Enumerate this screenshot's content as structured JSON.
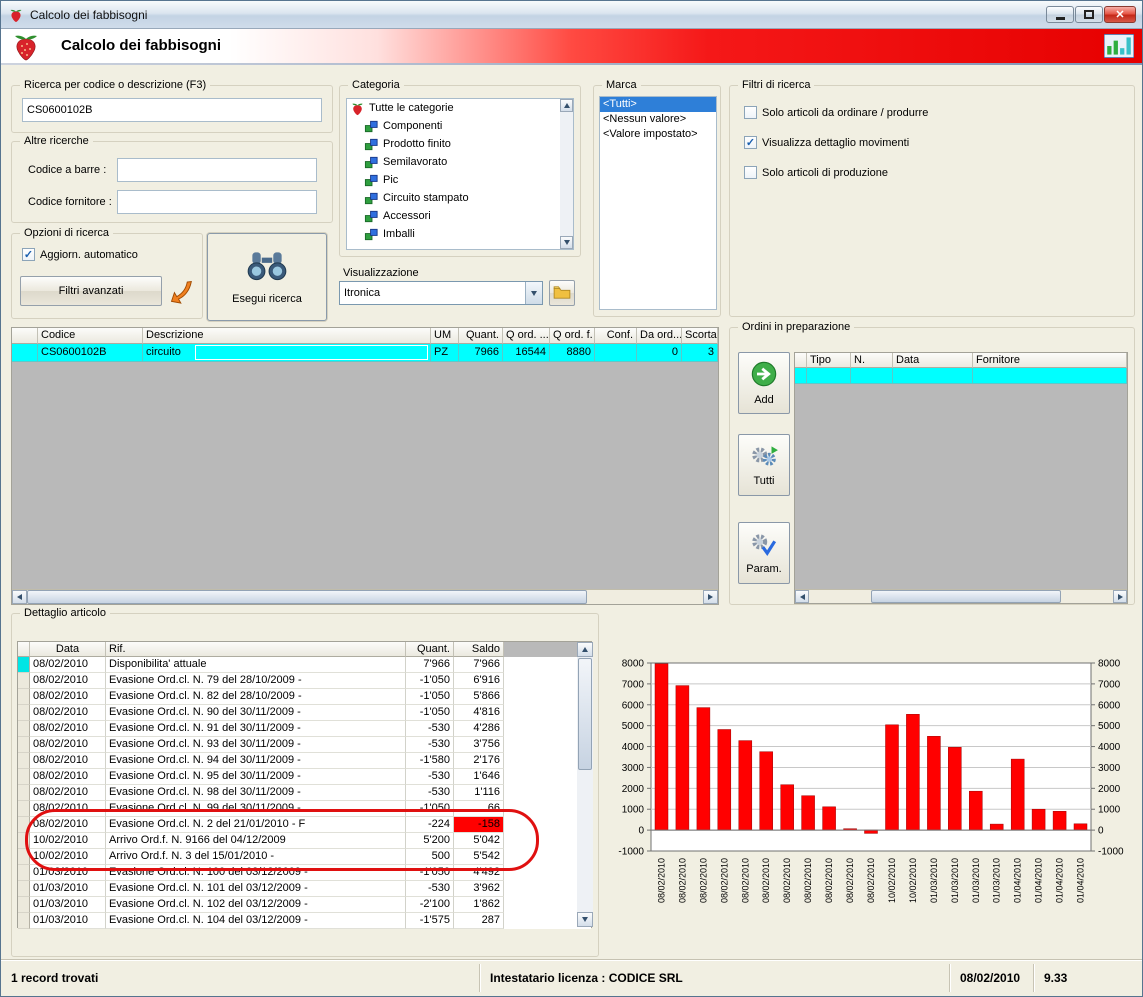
{
  "window": {
    "title": "Calcolo dei fabbisogni"
  },
  "banner": {
    "title": "Calcolo dei fabbisogni",
    "accent_color": "#e60000"
  },
  "search": {
    "group_label": "Ricerca per codice o descrizione (F3)",
    "value": "CS0600102B"
  },
  "other_search": {
    "group_label": "Altre ricerche",
    "barcode_label": "Codice a barre :",
    "barcode_value": "",
    "supplier_label": "Codice fornitore :",
    "supplier_value": ""
  },
  "options": {
    "group_label": "Opzioni di ricerca",
    "auto_update_label": "Aggiorn. automatico",
    "auto_update_checked": true,
    "advanced_filters_label": "Filtri avanzati"
  },
  "actions": {
    "execute_label": "Esegui ricerca"
  },
  "category": {
    "group_label": "Categoria",
    "items": [
      {
        "label": "Tutte le categorie",
        "root": true
      },
      {
        "label": "Componenti"
      },
      {
        "label": "Prodotto finito"
      },
      {
        "label": "Semilavorato"
      },
      {
        "label": "Pic"
      },
      {
        "label": "Circuito stampato"
      },
      {
        "label": "Accessori"
      },
      {
        "label": "Imballi"
      }
    ]
  },
  "visualization": {
    "label": "Visualizzazione",
    "value": "Itronica"
  },
  "marca": {
    "group_label": "Marca",
    "items": [
      {
        "label": "<Tutti>",
        "selected": true
      },
      {
        "label": "<Nessun valore>"
      },
      {
        "label": "<Valore impostato>"
      }
    ]
  },
  "filters": {
    "group_label": "Filtri di ricerca",
    "items": [
      {
        "label": "Solo articoli da ordinare / produrre",
        "checked": false
      },
      {
        "label": "Visualizza dettaglio movimenti",
        "checked": true
      },
      {
        "label": "Solo articoli di produzione",
        "checked": false
      }
    ]
  },
  "results_table": {
    "columns": [
      "Codice",
      "Descrizione",
      "UM",
      "Quant.",
      "Q ord. ...",
      "Q ord. f.",
      "Conf.",
      "Da ord...",
      "Scorta"
    ],
    "row": {
      "codice": "CS0600102B",
      "descrizione": "circuito",
      "um": "PZ",
      "quant": "7966",
      "q_ord": "16544",
      "q_ord_f": "8880",
      "conf": "",
      "da_ord": "0",
      "scorta": "3"
    }
  },
  "orders": {
    "group_label": "Ordini in preparazione",
    "buttons": [
      {
        "label": "Add"
      },
      {
        "label": "Tutti"
      },
      {
        "label": "Param."
      }
    ],
    "columns": [
      "Tipo",
      "N.",
      "Data",
      "Fornitore"
    ]
  },
  "detail": {
    "group_label": "Dettaglio articolo",
    "columns": [
      "Data",
      "Rif.",
      "Quant.",
      "Saldo"
    ],
    "rows": [
      {
        "data": "08/02/2010",
        "rif": "Disponibilita' attuale",
        "quant": "7'966",
        "saldo": "7'966",
        "selected": true
      },
      {
        "data": "08/02/2010",
        "rif": "Evasione Ord.cl. N. 79 del 28/10/2009 -",
        "quant": "-1'050",
        "saldo": "6'916"
      },
      {
        "data": "08/02/2010",
        "rif": "Evasione Ord.cl. N. 82 del 28/10/2009 -",
        "quant": "-1'050",
        "saldo": "5'866"
      },
      {
        "data": "08/02/2010",
        "rif": "Evasione Ord.cl. N. 90 del 30/11/2009 -",
        "quant": "-1'050",
        "saldo": "4'816"
      },
      {
        "data": "08/02/2010",
        "rif": "Evasione Ord.cl. N. 91 del 30/11/2009 -",
        "quant": "-530",
        "saldo": "4'286"
      },
      {
        "data": "08/02/2010",
        "rif": "Evasione Ord.cl. N. 93 del 30/11/2009 -",
        "quant": "-530",
        "saldo": "3'756"
      },
      {
        "data": "08/02/2010",
        "rif": "Evasione Ord.cl. N. 94 del 30/11/2009 -",
        "quant": "-1'580",
        "saldo": "2'176"
      },
      {
        "data": "08/02/2010",
        "rif": "Evasione Ord.cl. N. 95 del 30/11/2009 -",
        "quant": "-530",
        "saldo": "1'646"
      },
      {
        "data": "08/02/2010",
        "rif": "Evasione Ord.cl. N. 98 del 30/11/2009 -",
        "quant": "-530",
        "saldo": "1'116"
      },
      {
        "data": "08/02/2010",
        "rif": "Evasione Ord.cl. N. 99 del 30/11/2009 -",
        "quant": "-1'050",
        "saldo": "66"
      },
      {
        "data": "08/02/2010",
        "rif": "Evasione Ord.cl. N. 2 del 21/01/2010 - F",
        "quant": "-224",
        "saldo": "-158",
        "negative": true
      },
      {
        "data": "10/02/2010",
        "rif": "Arrivo Ord.f. N. 9166 del 04/12/2009",
        "quant": "5'200",
        "saldo": "5'042"
      },
      {
        "data": "10/02/2010",
        "rif": "Arrivo Ord.f. N. 3 del 15/01/2010 -",
        "quant": "500",
        "saldo": "5'542"
      },
      {
        "data": "01/03/2010",
        "rif": "Evasione Ord.cl. N. 100 del 03/12/2009 -",
        "quant": "-1'050",
        "saldo": "4'492"
      },
      {
        "data": "01/03/2010",
        "rif": "Evasione Ord.cl. N. 101 del 03/12/2009 -",
        "quant": "-530",
        "saldo": "3'962"
      },
      {
        "data": "01/03/2010",
        "rif": "Evasione Ord.cl. N. 102 del 03/12/2009 -",
        "quant": "-2'100",
        "saldo": "1'862"
      },
      {
        "data": "01/03/2010",
        "rif": "Evasione Ord.cl. N. 104 del 03/12/2009 -",
        "quant": "-1'575",
        "saldo": "287"
      }
    ]
  },
  "chart_data": {
    "type": "bar",
    "title": "",
    "xlabel": "",
    "ylabel": "",
    "categories": [
      "08/02/2010",
      "08/02/2010",
      "08/02/2010",
      "08/02/2010",
      "08/02/2010",
      "08/02/2010",
      "08/02/2010",
      "08/02/2010",
      "08/02/2010",
      "08/02/2010",
      "08/02/2010",
      "10/02/2010",
      "10/02/2010",
      "01/03/2010",
      "01/03/2010",
      "01/03/2010",
      "01/03/2010",
      "01/04/2010",
      "01/04/2010",
      "01/04/2010",
      "01/04/2010"
    ],
    "values": [
      7966,
      6916,
      5866,
      4816,
      4286,
      3756,
      2176,
      1646,
      1116,
      66,
      -158,
      5042,
      5542,
      4492,
      3962,
      1862,
      287,
      3400,
      1000,
      900,
      300
    ],
    "ylim": [
      -1000,
      8000
    ],
    "ytick_step": 1000,
    "bar_color": "#ff0000",
    "grid": true,
    "legend": "none"
  },
  "status_bar": {
    "records": "1 record trovati",
    "license": "Intestatario licenza : CODICE SRL",
    "date": "08/02/2010",
    "version": "9.33"
  }
}
